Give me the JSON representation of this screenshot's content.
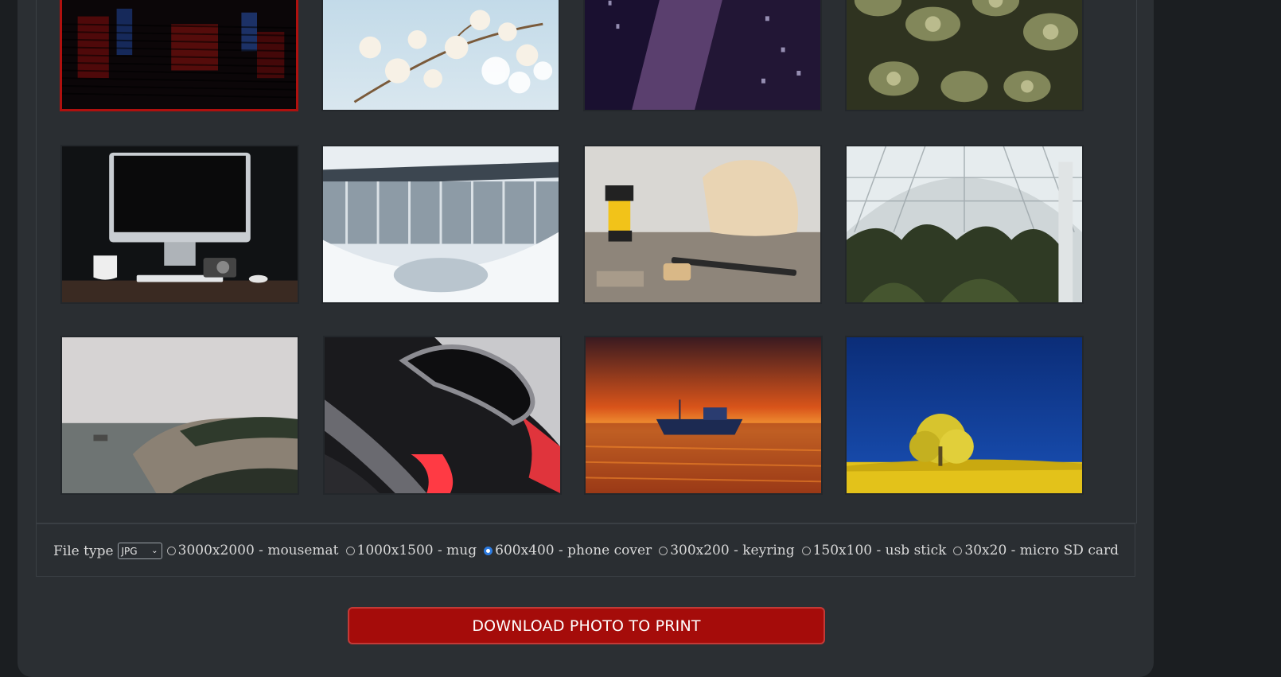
{
  "gallery": {
    "photos": [
      {
        "name": "red-neon-blinds-photo",
        "selected": true
      },
      {
        "name": "white-blossoms-photo",
        "selected": false
      },
      {
        "name": "purple-skyscrapers-photo",
        "selected": false
      },
      {
        "name": "green-succulents-photo",
        "selected": false
      },
      {
        "name": "desktop-computer-photo",
        "selected": false
      },
      {
        "name": "frozen-waterfall-photo",
        "selected": false
      },
      {
        "name": "woodworking-tools-photo",
        "selected": false
      },
      {
        "name": "greenhouse-interior-photo",
        "selected": false
      },
      {
        "name": "foggy-coastline-photo",
        "selected": false
      },
      {
        "name": "abstract-red-chrome-photo",
        "selected": false
      },
      {
        "name": "sunset-boat-photo",
        "selected": false
      },
      {
        "name": "yellow-tree-blue-sky-photo",
        "selected": false
      }
    ]
  },
  "options": {
    "file_type_label": "File type",
    "file_type_value": "JPG",
    "sizes": [
      {
        "label": "3000x2000 - mousemat",
        "checked": false
      },
      {
        "label": "1000x1500 - mug",
        "checked": false
      },
      {
        "label": "600x400 - phone cover",
        "checked": true
      },
      {
        "label": "300x200 - keyring",
        "checked": false
      },
      {
        "label": "150x100 - usb stick",
        "checked": false
      },
      {
        "label": "30x20 - micro SD card",
        "checked": false
      }
    ]
  },
  "download_button": {
    "label": "DOWNLOAD PHOTO TO PRINT"
  },
  "colors": {
    "accent": "#a50c0a",
    "radio_checked": "#2d7be0",
    "panel_bg": "#2b2f33",
    "page_bg": "#1b1e21"
  }
}
